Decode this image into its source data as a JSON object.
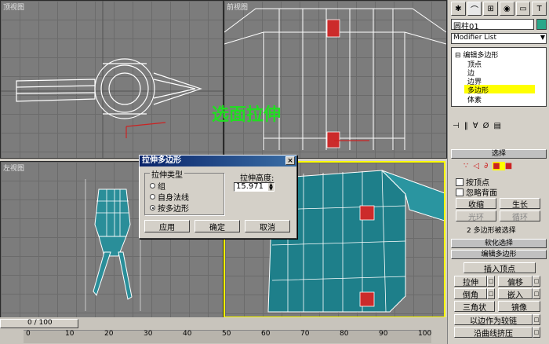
{
  "viewports": {
    "top": {
      "label": "顶视图"
    },
    "front": {
      "label": "前视图"
    },
    "left": {
      "label": "左视图"
    },
    "persp": {
      "label": ""
    }
  },
  "overlay_text": "选面拉伸",
  "overlay_color": "#22dd22",
  "dialog": {
    "title": "拉伸多边形",
    "close": "×",
    "group_label": "拉伸类型",
    "options": [
      "组",
      "自身法线",
      "按多边形"
    ],
    "selected_option": "按多边形",
    "height_label": "拉伸高度:",
    "height_value": "15.971",
    "apply": "应用",
    "ok": "确定",
    "cancel": "取消"
  },
  "panel": {
    "object_name": "圆柱01",
    "object_color": "#2aa88a",
    "modifier_list": "Modifier List",
    "stack": [
      "编辑多边形",
      "顶点",
      "边",
      "边界",
      "多边形",
      "体素"
    ],
    "stack_selected": "多边形",
    "selection_header": "选择",
    "by_vertex": "按顶点",
    "ignore_backface": "忽略背面",
    "shrink": "收缩",
    "grow": "生长",
    "ring": "光环",
    "loop": "循环",
    "sel_info": "2 多边形被选择",
    "soft_sel": "软化选择",
    "edit_poly": "编辑多边形",
    "insert_vertex": "插入顶点",
    "extrude": "拉伸",
    "outline": "偏移",
    "bevel": "倒角",
    "inset": "嵌入",
    "triangle": "三角状",
    "flip": "镜像",
    "hinge": "以边作为较链",
    "extrude_spline": "沿曲线挤压"
  },
  "timeline": {
    "frame": "0 / 100",
    "ticks": [
      "0",
      "10",
      "20",
      "30",
      "40",
      "50",
      "60",
      "70",
      "80",
      "90",
      "100"
    ]
  },
  "accent": "#ffff00",
  "mesh_color": "#1e7f8a",
  "selected_face_color": "#cc2b2b"
}
